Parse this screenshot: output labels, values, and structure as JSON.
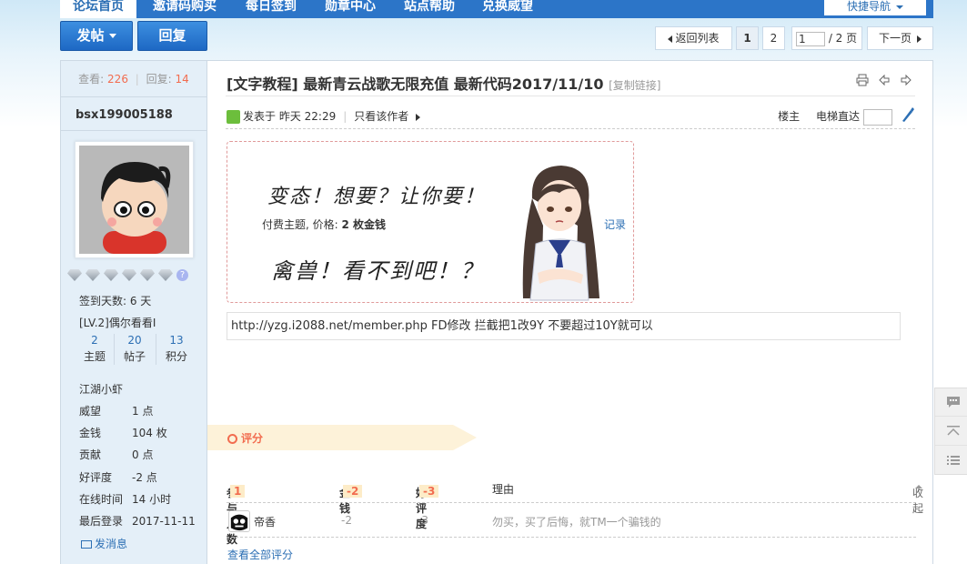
{
  "nav": {
    "items": [
      {
        "label": "论坛首页"
      },
      {
        "label": "邀请码购买"
      },
      {
        "label": "每日签到"
      },
      {
        "label": "勋章中心"
      },
      {
        "label": "站点帮助"
      },
      {
        "label": "兑换威望"
      }
    ],
    "quick_nav": "快捷导航"
  },
  "actions": {
    "post": "发帖",
    "reply": "回复"
  },
  "pager": {
    "back": "返回列表",
    "pages": [
      "1",
      "2"
    ],
    "current": "1",
    "total": "/ 2 页",
    "next": "下一页"
  },
  "sidebar": {
    "views_label": "查看:",
    "views": "226",
    "replies_label": "回复:",
    "replies": "14",
    "username": "bsx199005188",
    "signin_days": "签到天数: 6 天",
    "level": "[LV.2]偶尔看看I",
    "stats": [
      {
        "value": "2",
        "label": "主题"
      },
      {
        "value": "20",
        "label": "帖子"
      },
      {
        "value": "13",
        "label": "积分"
      }
    ],
    "rank": "江湖小虾",
    "info": [
      {
        "key": "威望",
        "value": "1 点"
      },
      {
        "key": "金钱",
        "value": "104 枚"
      },
      {
        "key": "贡献",
        "value": "0 点"
      },
      {
        "key": "好评度",
        "value": "-2 点"
      },
      {
        "key": "在线时间",
        "value": "14 小时"
      },
      {
        "key": "最后登录",
        "value": "2017-11-11"
      }
    ],
    "message": "发消息"
  },
  "post": {
    "title": "[文字教程] 最新青云战歌无限充值 最新代码2017/11/10",
    "copy_link": "[复制链接]",
    "posted": "发表于 昨天 22:29",
    "only_author": "只看该作者",
    "floor_label": "楼主",
    "jump_label": "电梯直达",
    "paywall": {
      "line1": "变态！想要？让你要！",
      "info_prefix": "付费主题, 价格:",
      "price": "2 枚金钱",
      "line2": "禽兽！看不到吧！？",
      "record": "记录"
    },
    "content": "http://yzg.i2088.net/member.php   FD修改   拦截把1改9Y  不要超过10Y就可以"
  },
  "rating": {
    "title": "评分",
    "participants_label": "参与人数",
    "participants": "1",
    "money_label": "金钱",
    "money": "-2",
    "rep_label": "好评度",
    "rep": "-3",
    "reason_label": "理由",
    "collapse": "收起",
    "rows": [
      {
        "user": "帝香",
        "money": "-2",
        "rep": "-3",
        "reason": "勿买，买了后悔，就TM一个骗钱的"
      }
    ],
    "view_all": "查看全部评分"
  },
  "colors": {
    "nav_blue": "#2c75c8",
    "link_blue": "#2c6fb4",
    "accent_orange": "#f26c4f",
    "sidebar_bg": "#e4eff8"
  }
}
